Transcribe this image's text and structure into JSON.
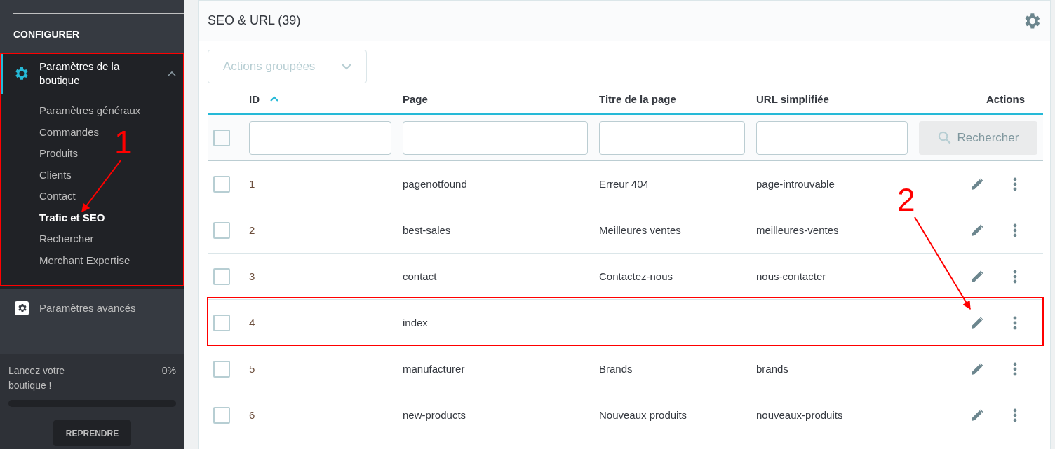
{
  "sidebar": {
    "section_heading": "CONFIGURER",
    "groups": [
      {
        "title": "Paramètres de la boutique",
        "expanded": true,
        "items": [
          {
            "label": "Paramètres généraux",
            "selected": false
          },
          {
            "label": "Commandes",
            "selected": false
          },
          {
            "label": "Produits",
            "selected": false
          },
          {
            "label": "Clients",
            "selected": false
          },
          {
            "label": "Contact",
            "selected": false
          },
          {
            "label": "Trafic et SEO",
            "selected": true
          },
          {
            "label": "Rechercher",
            "selected": false
          },
          {
            "label": "Merchant Expertise",
            "selected": false
          }
        ]
      },
      {
        "title": "Paramètres avancés",
        "expanded": false
      }
    ],
    "onboarding": {
      "text": "Lancez votre boutique !",
      "percent": "0%",
      "level": 0,
      "button": "REPRENDRE"
    }
  },
  "panel": {
    "title": "SEO & URL (39)",
    "bulk_actions": "Actions groupées",
    "columns": [
      {
        "label": "ID",
        "sorted": true
      },
      {
        "label": "Page",
        "sorted": false
      },
      {
        "label": "Titre de la page",
        "sorted": false
      },
      {
        "label": "URL simplifiée",
        "sorted": false
      },
      {
        "label": "Actions",
        "sorted": false
      }
    ],
    "select_all_checked": false,
    "search_button": "Rechercher",
    "rows": [
      {
        "id": "1",
        "page": "pagenotfound",
        "title": "Erreur 404",
        "url": "page-introuvable",
        "checked": false
      },
      {
        "id": "2",
        "page": "best-sales",
        "title": "Meilleures ventes",
        "url": "meilleures-ventes",
        "checked": false
      },
      {
        "id": "3",
        "page": "contact",
        "title": "Contactez-nous",
        "url": "nous-contacter",
        "checked": false
      },
      {
        "id": "4",
        "page": "index",
        "checked": false
      },
      {
        "id": "5",
        "page": "manufacturer",
        "title": "Brands",
        "url": "brands",
        "checked": false
      },
      {
        "id": "6",
        "page": "new-products",
        "title": "Nouveaux produits",
        "url": "nouveaux-produits",
        "checked": false
      }
    ]
  },
  "annotations": [
    {
      "label": "1"
    },
    {
      "label": "2"
    }
  ]
}
